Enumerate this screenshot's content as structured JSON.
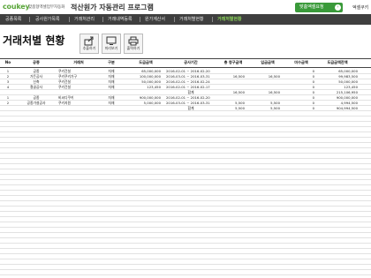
{
  "topbar": {
    "brand": "coukey",
    "brand_sub": "맞춤형엑셀업무자동화",
    "title": "적산원가 자동관리 프로그램",
    "custom_button": "맞춤엑셀요청",
    "edge_text": "엑셀쿠키"
  },
  "nav": {
    "items": [
      "공종목록",
      "공사원가목록",
      "거래처관리",
      "거래내역등록",
      "원가계산서",
      "거래처별현황",
      "거래처별현황"
    ],
    "active_index": 6
  },
  "page": {
    "title": "거래처별 현황",
    "tools": [
      {
        "label": "추출하기",
        "icon": "export-icon"
      },
      {
        "label": "미리보기",
        "icon": "monitor-icon"
      },
      {
        "label": "출력하기",
        "icon": "printer-icon"
      }
    ]
  },
  "table": {
    "headers": [
      "No",
      "공종",
      "거래처",
      "구분",
      "도급금액",
      "공사기간",
      "총 청구금액",
      "입금금액",
      "미수금액",
      "도급금액잔액"
    ],
    "rows": [
      {
        "no": "1",
        "kind": "공종",
        "vendor": "쿠키건설",
        "type": "자재",
        "amount": "65,000,000",
        "period": "2016-02-01 ~ 2016-02-20",
        "claim": "",
        "paid": "",
        "unpaid": "0",
        "balance": "65,000,000"
      },
      {
        "no": "2",
        "kind": "가든공사",
        "vendor": "쿠키쿠키가구",
        "type": "자재",
        "amount": "100,000,000",
        "period": "2016-03-01 ~ 2016-03-31",
        "claim": "16,500",
        "paid": "16,500",
        "unpaid": "0",
        "balance": "99,983,500"
      },
      {
        "no": "3",
        "kind": "신축",
        "vendor": "쿠키건설",
        "type": "자재",
        "amount": "50,000,000",
        "period": "2016-02-01 ~ 2016-02-24",
        "claim": "",
        "paid": "",
        "unpaid": "0",
        "balance": "50,000,000"
      },
      {
        "no": "4",
        "kind": "철골공사",
        "vendor": "쿠키건설",
        "type": "자재",
        "amount": "123,450",
        "period": "2016-02-01 ~ 2016-02-17",
        "claim": "",
        "paid": "",
        "unpaid": "0",
        "balance": "123,450"
      },
      {
        "no": "",
        "kind": "",
        "vendor": "",
        "type": "",
        "amount": "",
        "period": "합계",
        "claim": "16,500",
        "paid": "16,500",
        "unpaid": "0",
        "balance": "215,106,950"
      },
      {
        "no": "1",
        "kind": "공종",
        "vendor": "비씨디쿠키",
        "type": "자재",
        "amount": "900,000,000",
        "period": "2016-02-01 ~ 2016-02-20",
        "claim": "",
        "paid": "",
        "unpaid": "0",
        "balance": "900,000,000"
      },
      {
        "no": "2",
        "kind": "공종가설공사",
        "vendor": "쿠키지원",
        "type": "자재",
        "amount": "5,000,000",
        "period": "2016-03-01 ~ 2016-03-31",
        "claim": "5,500",
        "paid": "5,500",
        "unpaid": "0",
        "balance": "4,994,500"
      },
      {
        "no": "",
        "kind": "",
        "vendor": "",
        "type": "",
        "amount": "",
        "period": "합계",
        "claim": "5,500",
        "paid": "5,500",
        "unpaid": "0",
        "balance": "904,994,500"
      }
    ]
  },
  "colors": {
    "nav_bg": "#3f3f3f",
    "nav_active": "#8bd35a",
    "brand_green": "#5aa63a",
    "button_green": "#3a9a3a"
  }
}
